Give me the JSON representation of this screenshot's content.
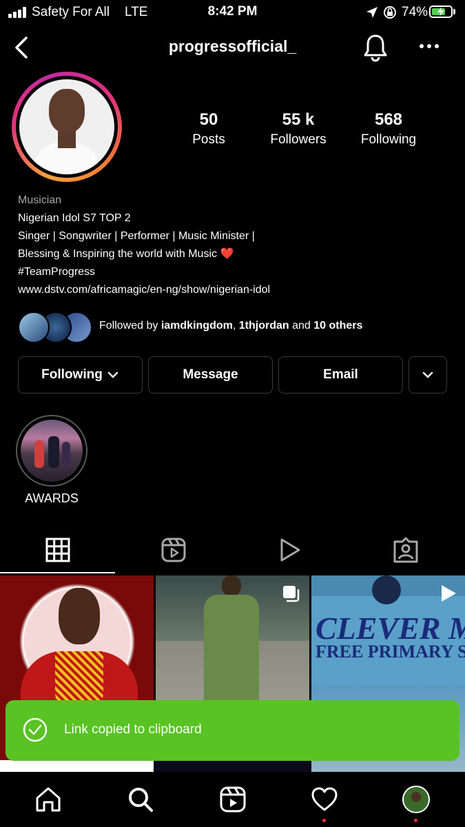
{
  "status_bar": {
    "carrier": "Safety For All",
    "network": "LTE",
    "time": "8:42 PM",
    "battery": "74%",
    "battery_level": 0.74
  },
  "header": {
    "username": "progressofficial_"
  },
  "stats": [
    {
      "value": "50",
      "label": "Posts"
    },
    {
      "value": "55 k",
      "label": "Followers"
    },
    {
      "value": "568",
      "label": "Following"
    }
  ],
  "bio": {
    "category": "Musician",
    "lines": [
      "Nigerian Idol S7 TOP 2",
      "Singer | Songwriter | Performer | Music Minister |",
      "Blessing & Inspiring the world with Music ❤️",
      "#TeamProgress"
    ],
    "link": "www.dstv.com/africamagic/en-ng/show/nigerian-idol"
  },
  "followed_by": {
    "prefix": "Followed by",
    "user1": "iamdkingdom",
    "separator": ",",
    "user2": "1thjordan",
    "and": "and",
    "others": "10 others"
  },
  "actions": {
    "following": "Following",
    "message": "Message",
    "email": "Email"
  },
  "highlights": [
    {
      "label": "AWARDS"
    }
  ],
  "toast": {
    "text": "Link copied to clipboard"
  },
  "colors": {
    "toast_bg": "#58c322",
    "notification_dot": "#ff3040",
    "battery_fill": "#4fd050"
  }
}
